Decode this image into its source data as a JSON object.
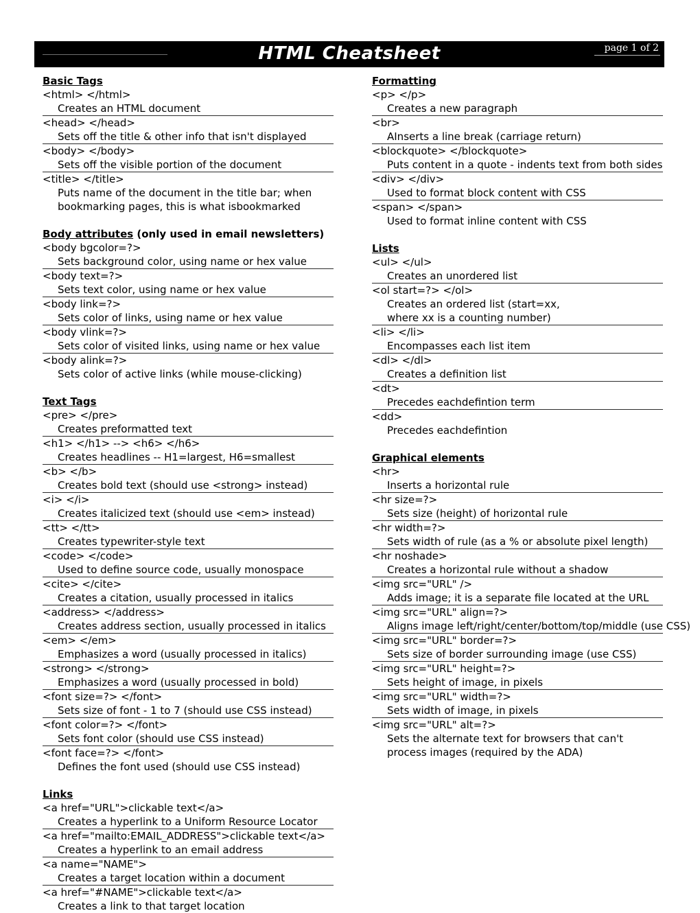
{
  "header": {
    "title": "HTML Cheatsheet",
    "page_indicator": "page 1 of 2"
  },
  "left_column": [
    {
      "heading_main": "Basic Tags",
      "heading_note": "",
      "entries": [
        {
          "tag": "<html> </html>",
          "desc": "Creates an HTML document",
          "ruled": true
        },
        {
          "tag": "<head> </head>",
          "desc": "Sets off the title & other info that isn't displayed",
          "ruled": true
        },
        {
          "tag": "<body> </body>",
          "desc": "Sets off the visible portion of the document",
          "ruled": true
        },
        {
          "tag": "<title> </title>",
          "desc": "Puts name of the document in the title bar; when\nbookmarking pages, this is what isbookmarked",
          "ruled": false
        }
      ]
    },
    {
      "heading_main": "Body attributes",
      "heading_note": " (only used in email newsletters)",
      "entries": [
        {
          "tag": "<body bgcolor=?>",
          "desc": "Sets background color, using name or hex value",
          "ruled": true
        },
        {
          "tag": "<body text=?>",
          "desc": "Sets text color, using name or hex value",
          "ruled": true
        },
        {
          "tag": "<body link=?>",
          "desc": "Sets color of links, using name or hex value",
          "ruled": true
        },
        {
          "tag": "<body vlink=?>",
          "desc": "Sets color of visited links, using name or hex value",
          "ruled": true
        },
        {
          "tag": "<body alink=?>",
          "desc": "Sets color of active links (while mouse-clicking)",
          "ruled": false
        }
      ]
    },
    {
      "heading_main": "Text Tags",
      "heading_note": "",
      "entries": [
        {
          "tag": "<pre> </pre>",
          "desc": "Creates preformatted text",
          "ruled": true
        },
        {
          "tag": "<h1> </h1> --> <h6> </h6>",
          "desc": "Creates headlines -- H1=largest, H6=smallest",
          "ruled": true
        },
        {
          "tag": "<b> </b>",
          "desc": "Creates bold text (should use <strong> instead)",
          "ruled": true
        },
        {
          "tag": "<i> </i>",
          "desc": "Creates italicized text (should use <em> instead)",
          "ruled": true
        },
        {
          "tag": "<tt> </tt>",
          "desc": "Creates typewriter-style text",
          "ruled": true
        },
        {
          "tag": "<code> </code>",
          "desc": "Used to define source code, usually monospace",
          "ruled": true
        },
        {
          "tag": "<cite> </cite>",
          "desc": "Creates a citation, usually processed in italics",
          "ruled": true
        },
        {
          "tag": "<address> </address>",
          "desc": "Creates address section, usually processed in italics",
          "ruled": true
        },
        {
          "tag": "<em> </em>",
          "desc": "Emphasizes a word (usually processed in italics)",
          "ruled": true
        },
        {
          "tag": "<strong> </strong>",
          "desc": "Emphasizes a word (usually processed in bold)",
          "ruled": true
        },
        {
          "tag": "<font size=?> </font>",
          "desc": "Sets size of font - 1 to 7 (should use CSS instead)",
          "ruled": true
        },
        {
          "tag": "<font color=?> </font>",
          "desc": "Sets font color (should use CSS instead)",
          "ruled": true
        },
        {
          "tag": "<font face=?> </font>",
          "desc": "Defines the font used (should use CSS instead)",
          "ruled": false
        }
      ]
    },
    {
      "heading_main": "Links",
      "heading_note": "",
      "entries": [
        {
          "tag": "<a href=\"URL\">clickable text</a>",
          "desc": "Creates a hyperlink to a Uniform Resource Locator",
          "ruled": true
        },
        {
          "tag": "<a href=\"mailto:EMAIL_ADDRESS\">clickable text</a>",
          "desc": "Creates a hyperlink to an email address",
          "ruled": true
        },
        {
          "tag": "<a name=\"NAME\">",
          "desc": "Creates a target location within a document",
          "ruled": true
        },
        {
          "tag": "<a href=\"#NAME\">clickable text</a>",
          "desc": "Creates a link to that target location",
          "ruled": false
        }
      ]
    }
  ],
  "right_column": [
    {
      "heading_main": "Formatting",
      "heading_note": "",
      "entries": [
        {
          "tag": "<p> </p>",
          "desc": "Creates a new paragraph",
          "ruled": true
        },
        {
          "tag": "<br>",
          "desc": "AInserts a line break (carriage return)",
          "ruled": true
        },
        {
          "tag": "<blockquote> </blockquote>",
          "desc": "Puts content in a quote - indents text from both sides",
          "ruled": true
        },
        {
          "tag": "<div> </div>",
          "desc": "Used to format block content with CSS",
          "ruled": true
        },
        {
          "tag": "<span> </span>",
          "desc": "Used to format inline content with CSS",
          "ruled": false
        }
      ]
    },
    {
      "heading_main": "Lists",
      "heading_note": "",
      "entries": [
        {
          "tag": "<ul> </ul>",
          "desc": "Creates an unordered list",
          "ruled": true
        },
        {
          "tag": "<ol start=?> </ol>",
          "desc": "Creates an ordered list (start=xx,\nwhere xx is a counting number)",
          "ruled": true
        },
        {
          "tag": "<li> </li>",
          "desc": "Encompasses each list item",
          "ruled": true
        },
        {
          "tag": "<dl> </dl>",
          "desc": "Creates a definition list",
          "ruled": true
        },
        {
          "tag": "<dt>",
          "desc": "Precedes eachdefintion term",
          "ruled": true
        },
        {
          "tag": "<dd>",
          "desc": "Precedes eachdefintion",
          "ruled": false
        }
      ]
    },
    {
      "heading_main": "Graphical elements",
      "heading_note": "",
      "entries": [
        {
          "tag": "<hr>",
          "desc": "Inserts a horizontal rule",
          "ruled": true
        },
        {
          "tag": "<hr size=?>",
          "desc": "Sets size (height) of horizontal rule",
          "ruled": true
        },
        {
          "tag": "<hr width=?>",
          "desc": "Sets width of rule (as a % or absolute pixel length)",
          "ruled": true
        },
        {
          "tag": "<hr noshade>",
          "desc": "Creates a horizontal rule without a shadow",
          "ruled": true
        },
        {
          "tag": "<img src=\"URL\" />",
          "desc": "Adds image; it is a separate file located at the URL",
          "ruled": true
        },
        {
          "tag": "<img src=\"URL\" align=?>",
          "desc": "Aligns image left/right/center/bottom/top/middle (use CSS)",
          "ruled": true
        },
        {
          "tag": "<img src=\"URL\" border=?>",
          "desc": "Sets size of border surrounding image (use CSS)",
          "ruled": true
        },
        {
          "tag": "<img src=\"URL\" height=?>",
          "desc": "Sets height of image, in pixels",
          "ruled": true
        },
        {
          "tag": "<img src=\"URL\" width=?>",
          "desc": "Sets width of image, in pixels",
          "ruled": true
        },
        {
          "tag": "<img src=\"URL\" alt=?>",
          "desc": "Sets the alternate text for browsers that can't\nprocess images (required by the ADA)",
          "ruled": false
        }
      ]
    }
  ]
}
